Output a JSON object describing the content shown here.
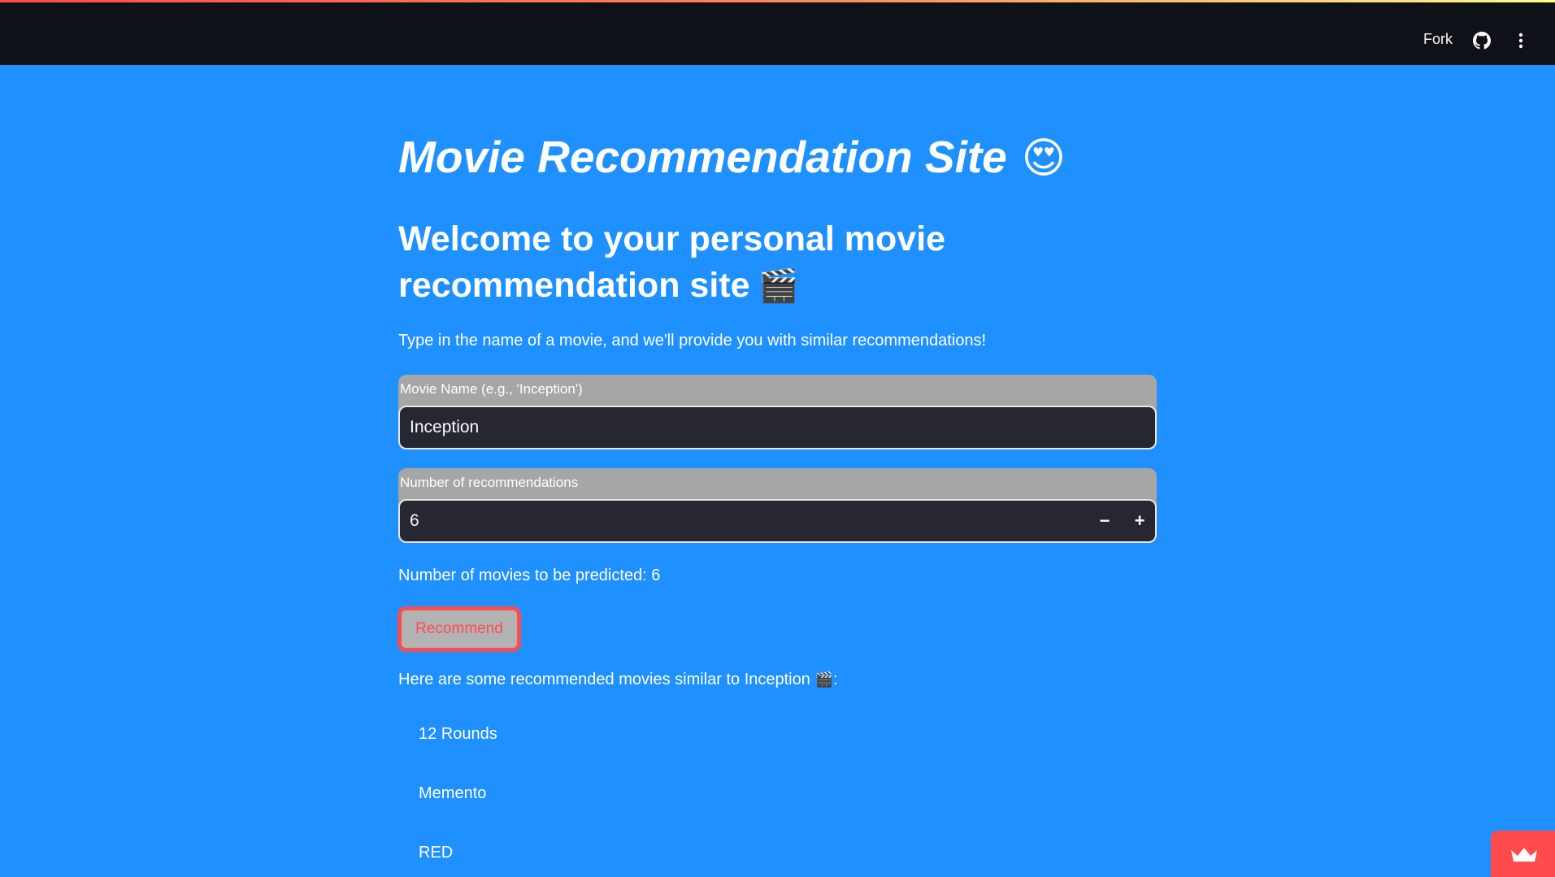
{
  "header": {
    "fork_label": "Fork",
    "github_icon": "github-icon",
    "menu_icon": "more-vert-icon"
  },
  "main": {
    "title": "Movie Recommendation Site",
    "title_emoji": "😍",
    "subtitle": "Welcome to your personal movie recommendation site",
    "subtitle_emoji": "🎬",
    "intro": "Type in the name of a movie, and we'll provide you with similar recommendations!",
    "movie_field": {
      "label": "Movie Name (e.g., 'Inception')",
      "value": "Inception"
    },
    "count_field": {
      "label": "Number of recommendations",
      "value": "6",
      "minus": "−",
      "plus": "+"
    },
    "predicted_text": "Number of movies to be predicted: 6",
    "recommend_label": "Recommend",
    "results_intro": "Here are some recommended movies similar to Inception",
    "results_emoji": "🎬",
    "results_suffix": ":",
    "results": [
      "12 Rounds",
      "Memento",
      "RED"
    ]
  },
  "colors": {
    "background": "#1e90ff",
    "header": "#0e1117",
    "input_bg": "#262730",
    "accent": "#ff4b4b"
  },
  "badge": {
    "icon": "crown-icon"
  }
}
